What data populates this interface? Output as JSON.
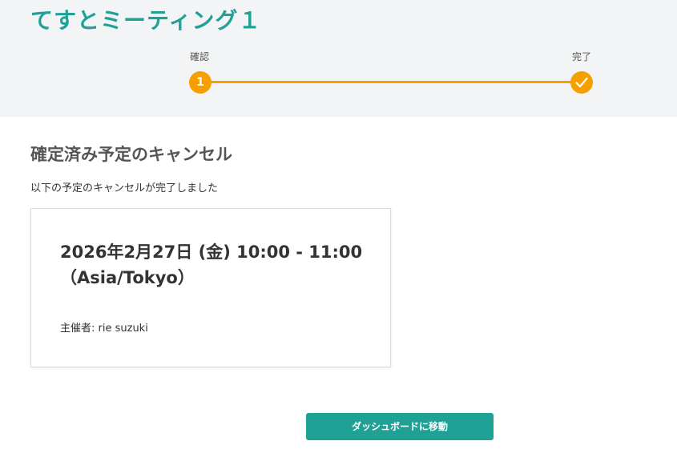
{
  "header": {
    "meeting_title": "てすとミーティング１"
  },
  "steps": [
    {
      "label": "確認",
      "marker": "1"
    },
    {
      "label": "完了",
      "marker_icon": "check-icon"
    }
  ],
  "colors": {
    "brand": "#1fa196",
    "step_accent": "#f5a000",
    "header_background": "#f3f4f5"
  },
  "main": {
    "section_title": "確定済み予定のキャンセル",
    "message": "以下の予定のキャンセルが完了しました",
    "card": {
      "datetime": "2026年2月27日 (金) 10:00 - 11:00",
      "timezone": "（Asia/Tokyo）",
      "host_label": "主催者: ",
      "host_name": "rie suzuki"
    },
    "dashboard_button_label": "ダッシュボードに移動"
  }
}
